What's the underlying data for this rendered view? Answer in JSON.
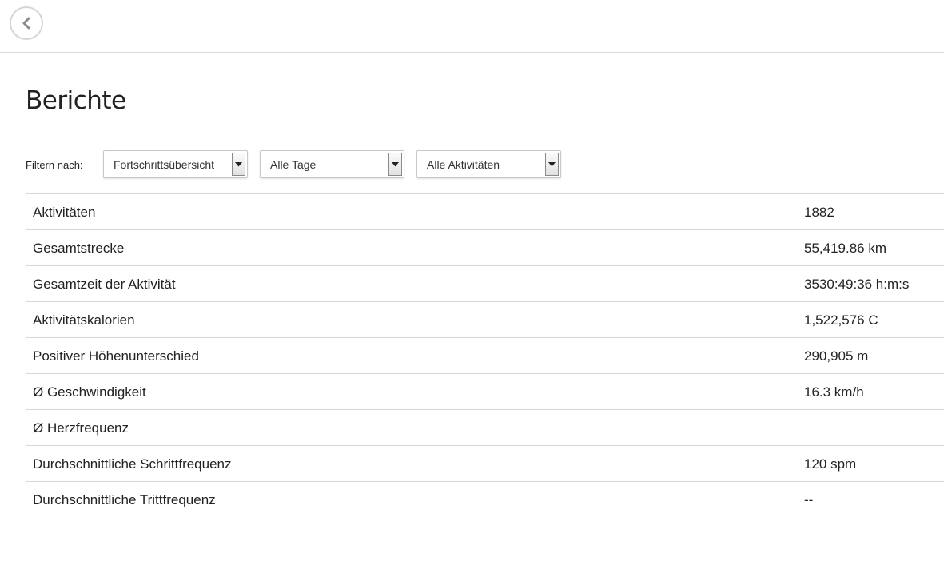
{
  "header": {
    "back_icon": "chevron-left-icon"
  },
  "page": {
    "title": "Berichte"
  },
  "filters": {
    "label": "Filtern nach:",
    "report_type": "Fortschrittsübersicht",
    "time_range": "Alle Tage",
    "activity_type": "Alle Aktivitäten"
  },
  "stats": [
    {
      "label": "Aktivitäten",
      "value": "1882"
    },
    {
      "label": "Gesamtstrecke",
      "value": "55,419.86 km"
    },
    {
      "label": "Gesamtzeit der Aktivität",
      "value": "3530:49:36 h:m:s"
    },
    {
      "label": "Aktivitätskalorien",
      "value": "1,522,576 C"
    },
    {
      "label": "Positiver Höhenunterschied",
      "value": "290,905 m"
    },
    {
      "label": "Ø Geschwindigkeit",
      "value": "16.3 km/h"
    },
    {
      "label": "Ø Herzfrequenz",
      "value": ""
    },
    {
      "label": "Durchschnittliche Schrittfrequenz",
      "value": "120 spm"
    },
    {
      "label": "Durchschnittliche Trittfrequenz",
      "value": "--"
    }
  ],
  "colors": {
    "divider": "#d6d6d6",
    "text": "#222222"
  }
}
